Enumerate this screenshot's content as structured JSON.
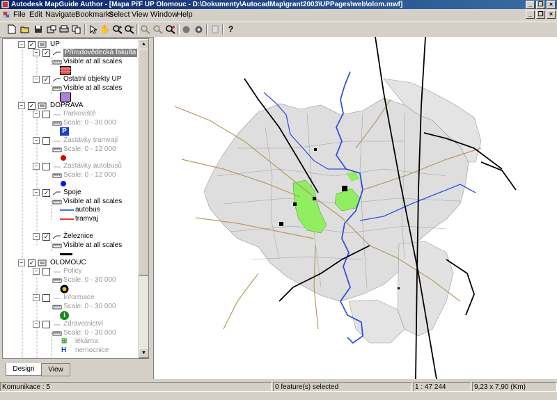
{
  "window": {
    "title": "Autodesk MapGuide Author - [Mapa PřF UP Olomouc - D:\\Dokumenty\\AutocadMap\\grant2003\\UPPages\\web\\olom.mwf]"
  },
  "menu": [
    "File",
    "Edit",
    "Navigate",
    "Bookmarks",
    "Select",
    "View",
    "Window",
    "Help"
  ],
  "toolbar": {
    "icons": [
      "new-icon",
      "open-icon",
      "save-icon",
      "print-setup-icon",
      "print-icon",
      "copy-icon",
      "select-arrow-icon",
      "pan-hand-icon",
      "zoom-in-icon",
      "zoom-out-icon",
      "zoom-window-icon",
      "zoom-previous-icon",
      "zoom-extents-icon",
      "circle-icon",
      "refresh-icon",
      "layer-icon",
      "help-icon"
    ]
  },
  "legend": {
    "groups": [
      {
        "name": "UP",
        "layers": [
          {
            "name": "Přírodovědecká fakulta",
            "scale": "Visible at all scales",
            "selected": true,
            "visible": true
          },
          {
            "name": "Ostatní objekty UP",
            "scale": "Visible at all scales",
            "visible": true
          }
        ]
      },
      {
        "name": "DOPRAVA",
        "layers": [
          {
            "name": "Parkoviště",
            "scale": "Scale: 0 - 30 000",
            "visible": false
          },
          {
            "name": "Zastávky tramvají",
            "scale": "Scale: 0 - 12 000",
            "visible": false
          },
          {
            "name": "Zastávky autobusů",
            "scale": "Scale: 0 - 12 000",
            "visible": false
          },
          {
            "name": "Spoje",
            "scale": "Visible at all scales",
            "visible": true,
            "items": [
              "autobus",
              "tramvaj"
            ]
          },
          {
            "name": "Železnice",
            "scale": "Visible at all scales",
            "visible": true
          }
        ]
      },
      {
        "name": "OLOMOUC",
        "layers": [
          {
            "name": "Policy",
            "scale": "Scale: 0 - 30 000",
            "visible": false
          },
          {
            "name": "Informace",
            "scale": "Scale: 0 - 30 000",
            "visible": false
          },
          {
            "name": "Zdravotnictví",
            "scale": "Scale: 0 - 30 000",
            "visible": false,
            "items": [
              "lékárna",
              "nemocnice"
            ]
          }
        ]
      }
    ],
    "icon_glyphs": {
      "parking": "P",
      "info": "i",
      "pharmacy": "⊞",
      "hospital": "H"
    }
  },
  "tabs": {
    "design": "Design",
    "view": "View"
  },
  "status": {
    "layer": "Komunikace : 5",
    "selection": "0 feature(s) selected",
    "scale": "1 : 47 244",
    "size": "9,23 x 7,90 (Km)"
  },
  "colors": {
    "titlebar": "#0a246a",
    "faculty": "#e05050",
    "other_up": "#b080e0",
    "bus": "#4a6fe0",
    "tram": "#e04040",
    "river": "#3050e0",
    "green": "#90ee60"
  }
}
